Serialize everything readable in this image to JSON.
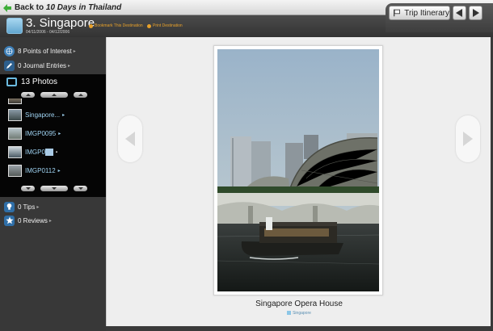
{
  "top_bar": {
    "back_prefix": "Back to",
    "back_trip": "10 Days in Thailand"
  },
  "header": {
    "title": "3. Singapore",
    "dates": "04/11/2006 - 04/12/2006",
    "bookmark_label": "Bookmark This Destination",
    "print_label": "Print Destination",
    "trip_itinerary_label": "Trip Itinerary",
    "accent_color": "#e8a12a"
  },
  "sidebar": {
    "points_of_interest": "8 Points of Interest",
    "journal_entries": "0 Journal Entries",
    "photos_label": "13 Photos",
    "photos": [
      {
        "name": "Singapore..."
      },
      {
        "name": "IMGP0095"
      },
      {
        "name": "IMGP0"
      },
      {
        "name": "IMGP0112"
      }
    ],
    "tips": "0 Tips",
    "reviews": "0 Reviews",
    "icons": [
      "globe-icon",
      "pencil-icon",
      "photo-icon",
      "lightbulb-icon",
      "star-icon"
    ]
  },
  "photo": {
    "caption": "Singapore Opera House",
    "location": "Singapore"
  }
}
